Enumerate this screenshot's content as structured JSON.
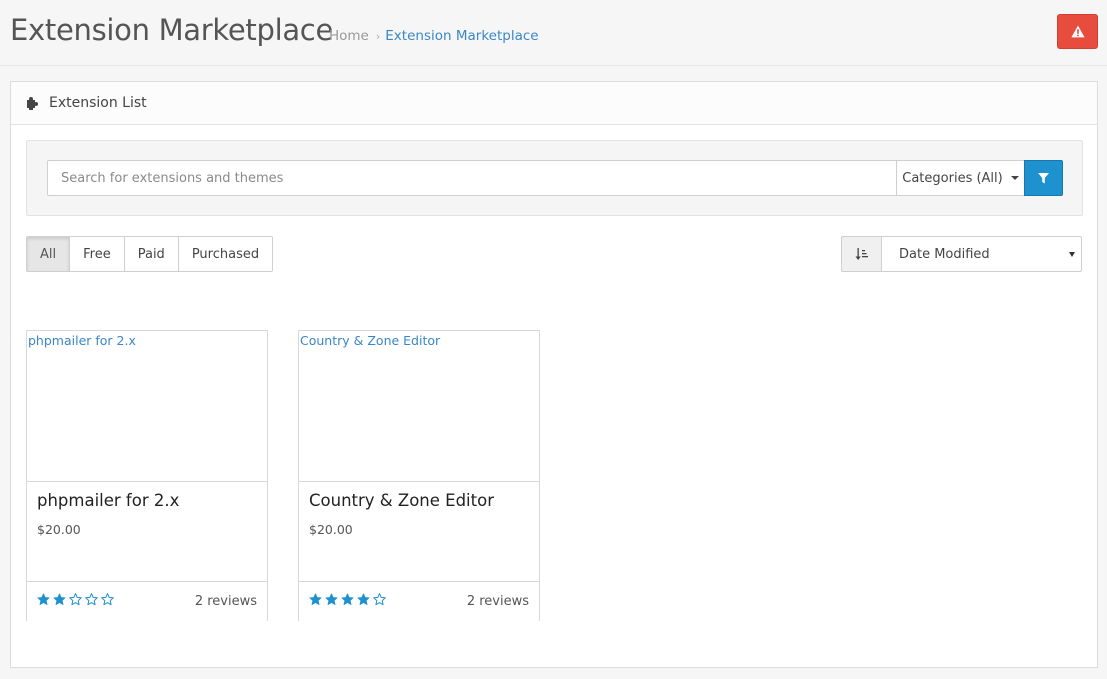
{
  "header": {
    "title": "Extension Marketplace",
    "breadcrumb": {
      "home": "Home",
      "separator": "›",
      "current": "Extension Marketplace"
    },
    "alert_icon": "warning-icon"
  },
  "panel": {
    "icon": "puzzle-icon",
    "title": "Extension List",
    "search": {
      "placeholder": "Search for extensions and themes",
      "value": "",
      "categories_label": "Categories (All)",
      "filter_icon": "filter-icon"
    },
    "type_filters": [
      {
        "label": "All",
        "active": true
      },
      {
        "label": "Free",
        "active": false
      },
      {
        "label": "Paid",
        "active": false
      },
      {
        "label": "Purchased",
        "active": false
      }
    ],
    "sort": {
      "icon": "sort-amount-icon",
      "selected": "Date Modified"
    }
  },
  "extensions": [
    {
      "image_alt": "phpmailer for 2.x",
      "name": "phpmailer for 2.x",
      "price": "$20.00",
      "rating": 2,
      "max_rating": 5,
      "reviews": "2 reviews"
    },
    {
      "image_alt": "Country & Zone Editor",
      "name": "Country & Zone Editor",
      "price": "$20.00",
      "rating": 4,
      "max_rating": 5,
      "reviews": "2 reviews"
    }
  ],
  "colors": {
    "accent": "#1e91cf",
    "danger": "#e74c3c",
    "link": "#3a87c8",
    "star": "#1e91cf"
  }
}
